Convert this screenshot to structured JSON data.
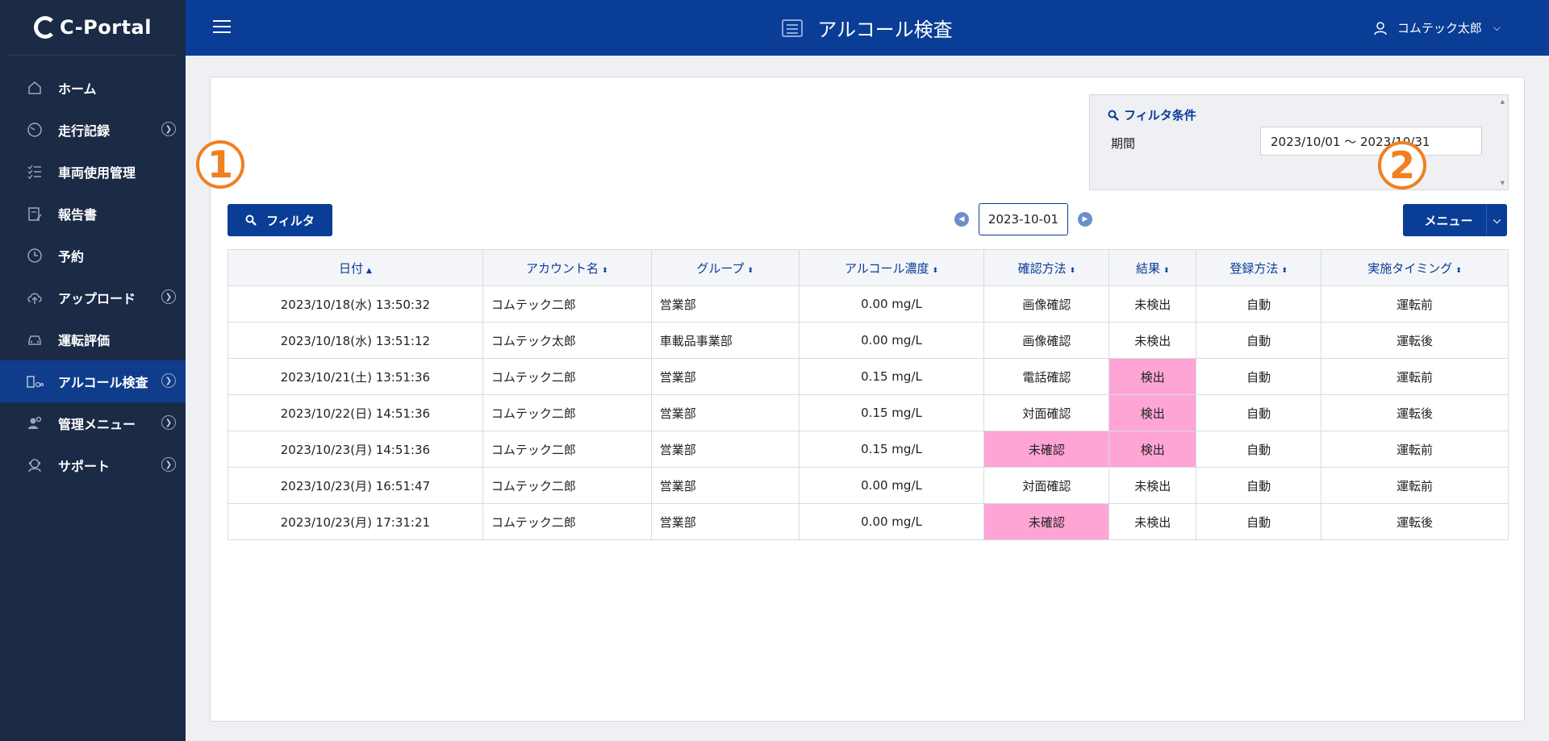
{
  "app": {
    "logo_text": "C-Portal"
  },
  "sidebar": {
    "items": [
      {
        "label": "ホーム",
        "icon": "home-icon",
        "chevron": false,
        "active": false
      },
      {
        "label": "走行記録",
        "icon": "speedometer-icon",
        "chevron": true,
        "active": false
      },
      {
        "label": "車両使用管理",
        "icon": "checklist-icon",
        "chevron": false,
        "active": false
      },
      {
        "label": "報告書",
        "icon": "report-icon",
        "chevron": false,
        "active": false
      },
      {
        "label": "予約",
        "icon": "clock-icon",
        "chevron": false,
        "active": false
      },
      {
        "label": "アップロード",
        "icon": "cloud-upload-icon",
        "chevron": true,
        "active": false
      },
      {
        "label": "運転評価",
        "icon": "car-icon",
        "chevron": false,
        "active": false
      },
      {
        "label": "アルコール検査",
        "icon": "alcohol-test-icon",
        "chevron": true,
        "active": true
      },
      {
        "label": "管理メニュー",
        "icon": "admin-gear-icon",
        "chevron": true,
        "active": false
      },
      {
        "label": "サポート",
        "icon": "support-icon",
        "chevron": true,
        "active": false
      }
    ]
  },
  "header": {
    "title": "アルコール検査",
    "user_name": "コムテック太郎"
  },
  "filter": {
    "title": "フィルタ条件",
    "period_label": "期間",
    "period_value": "2023/10/01 〜 2023/10/31",
    "button_label": "フィルタ"
  },
  "date_nav": {
    "date": "2023-10-01"
  },
  "menu_button": {
    "label": "メニュー"
  },
  "annotations": {
    "one": "1",
    "two": "2"
  },
  "table": {
    "columns": [
      {
        "label": "日付",
        "sort": "▲"
      },
      {
        "label": "アカウント名",
        "sort": "⬍"
      },
      {
        "label": "グループ",
        "sort": "⬍"
      },
      {
        "label": "アルコール濃度",
        "sort": "⬍"
      },
      {
        "label": "確認方法",
        "sort": "⬍"
      },
      {
        "label": "結果",
        "sort": "⬍"
      },
      {
        "label": "登録方法",
        "sort": "⬍"
      },
      {
        "label": "実施タイミング",
        "sort": "⬍"
      }
    ],
    "rows": [
      {
        "date": "2023/10/18(水) 13:50:32",
        "account": "コムテック二郎",
        "group": "営業部",
        "concentration": "0.00 mg/L",
        "method": "画像確認",
        "method_alert": false,
        "result": "未検出",
        "result_alert": false,
        "registration": "自動",
        "timing": "運転前"
      },
      {
        "date": "2023/10/18(水) 13:51:12",
        "account": "コムテック太郎",
        "group": "車載品事業部",
        "concentration": "0.00 mg/L",
        "method": "画像確認",
        "method_alert": false,
        "result": "未検出",
        "result_alert": false,
        "registration": "自動",
        "timing": "運転後"
      },
      {
        "date": "2023/10/21(土) 13:51:36",
        "account": "コムテック二郎",
        "group": "営業部",
        "concentration": "0.15 mg/L",
        "method": "電話確認",
        "method_alert": false,
        "result": "検出",
        "result_alert": true,
        "registration": "自動",
        "timing": "運転前"
      },
      {
        "date": "2023/10/22(日) 14:51:36",
        "account": "コムテック二郎",
        "group": "営業部",
        "concentration": "0.15 mg/L",
        "method": "対面確認",
        "method_alert": false,
        "result": "検出",
        "result_alert": true,
        "registration": "自動",
        "timing": "運転後"
      },
      {
        "date": "2023/10/23(月) 14:51:36",
        "account": "コムテック二郎",
        "group": "営業部",
        "concentration": "0.15 mg/L",
        "method": "未確認",
        "method_alert": true,
        "result": "検出",
        "result_alert": true,
        "registration": "自動",
        "timing": "運転前"
      },
      {
        "date": "2023/10/23(月) 16:51:47",
        "account": "コムテック二郎",
        "group": "営業部",
        "concentration": "0.00 mg/L",
        "method": "対面確認",
        "method_alert": false,
        "result": "未検出",
        "result_alert": false,
        "registration": "自動",
        "timing": "運転前"
      },
      {
        "date": "2023/10/23(月) 17:31:21",
        "account": "コムテック二郎",
        "group": "営業部",
        "concentration": "0.00 mg/L",
        "method": "未確認",
        "method_alert": true,
        "result": "未検出",
        "result_alert": false,
        "registration": "自動",
        "timing": "運転後"
      }
    ]
  },
  "colors": {
    "primary": "#0a3d96",
    "sidebar": "#1b2a45",
    "alert": "#ffa5d5",
    "annotation": "#f08020"
  }
}
